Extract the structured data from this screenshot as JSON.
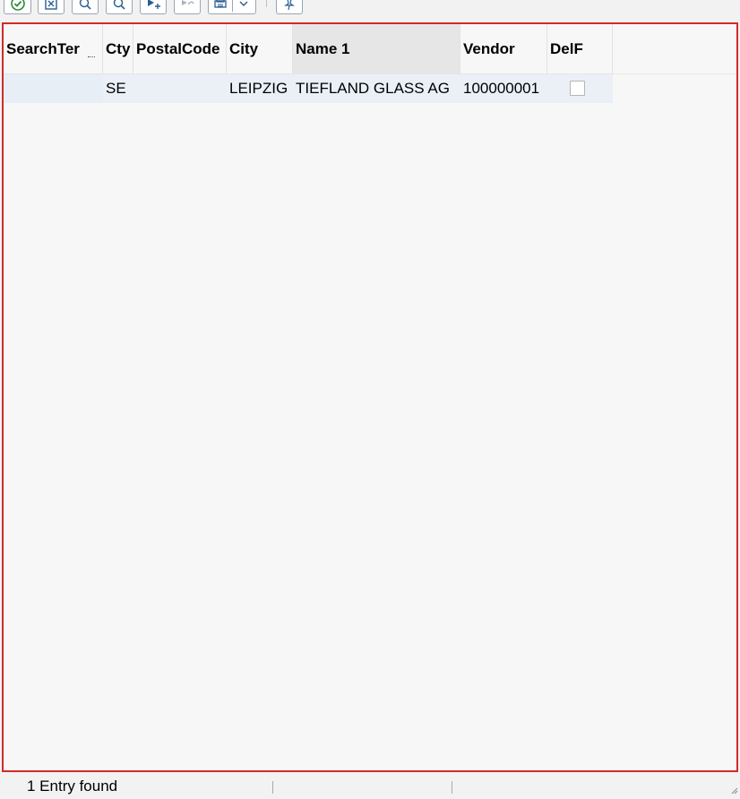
{
  "toolbar": {
    "buttons": [
      {
        "name": "continue-button",
        "icon": "checkmark-circle-icon"
      },
      {
        "name": "cancel-button",
        "icon": "close-box-icon"
      },
      {
        "name": "find-button",
        "icon": "magnifier-icon"
      },
      {
        "name": "find-next-button",
        "icon": "magnifier-next-icon"
      },
      {
        "name": "add-to-personal-list-button",
        "icon": "pin-add-icon"
      },
      {
        "name": "remove-from-personal-list-button",
        "icon": "pin-remove-icon"
      },
      {
        "name": "print-button",
        "icon": "printer-icon"
      },
      {
        "name": "print-dropdown-button",
        "icon": "chevron-down-icon"
      },
      {
        "name": "hold-values-button",
        "icon": "pushpin-icon"
      }
    ]
  },
  "grid": {
    "columns": [
      {
        "key": "search_term",
        "label": "SearchTer"
      },
      {
        "key": "country",
        "label": "Cty"
      },
      {
        "key": "postal_code",
        "label": "PostalCode"
      },
      {
        "key": "city",
        "label": "City"
      },
      {
        "key": "name1",
        "label": "Name 1"
      },
      {
        "key": "vendor",
        "label": "Vendor"
      },
      {
        "key": "delf",
        "label": "DelF"
      }
    ],
    "rows": [
      {
        "search_term": "",
        "country": "SE",
        "postal_code": "",
        "city": "LEIPZIG",
        "name1": "TIEFLAND GLASS AG",
        "vendor": "100000001",
        "delf": false
      }
    ]
  },
  "status": {
    "message": "1 Entry found"
  },
  "colors": {
    "frame_border": "#d22a2a",
    "row_highlight": "#eaf0f6",
    "active_column": "#e6e6e6"
  }
}
